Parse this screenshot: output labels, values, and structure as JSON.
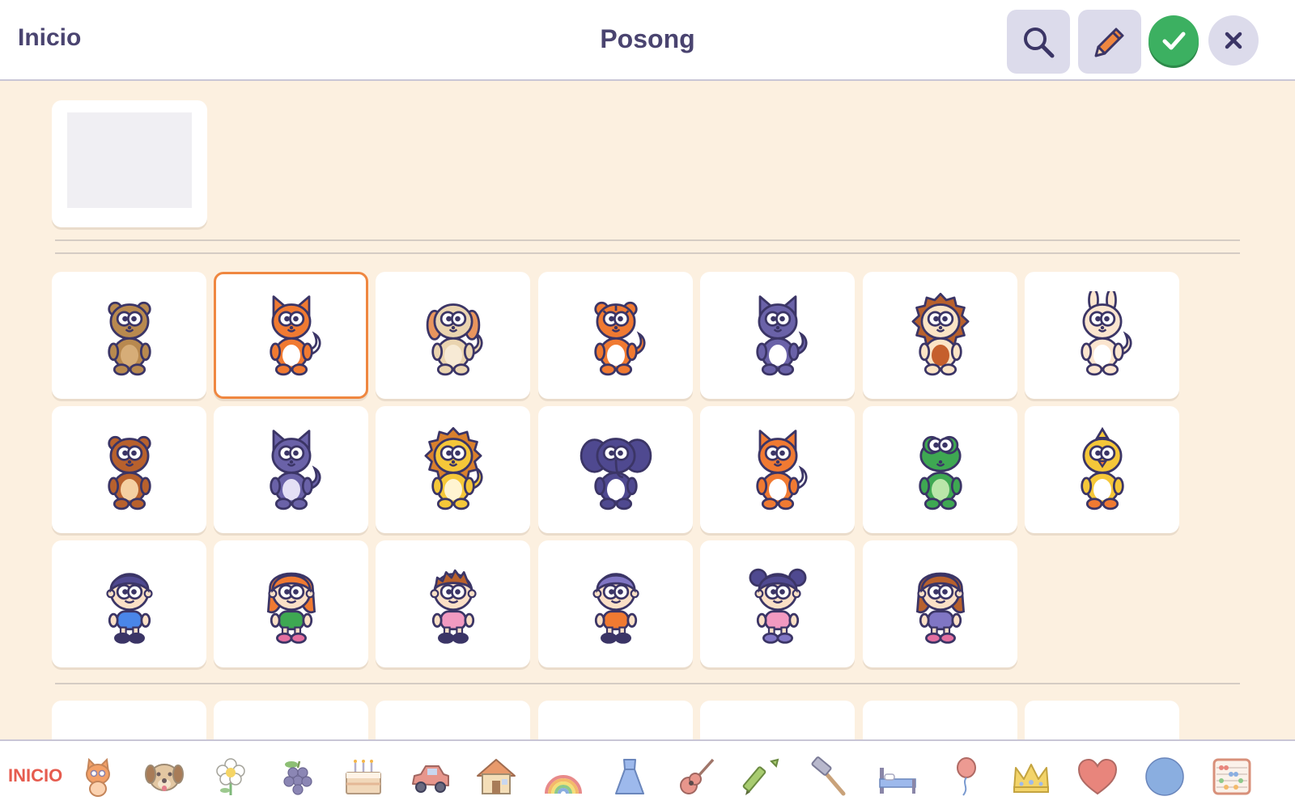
{
  "header": {
    "home_label": "Inicio",
    "title": "Posong",
    "buttons": [
      {
        "name": "search-button",
        "icon": "search-icon"
      },
      {
        "name": "edit-button",
        "icon": "pencil-icon"
      },
      {
        "name": "confirm-button",
        "icon": "check-icon"
      },
      {
        "name": "close-button",
        "icon": "close-icon"
      }
    ]
  },
  "colors": {
    "background": "#fcf0e0",
    "header_text": "#4a4470",
    "selected_border": "#ef8740",
    "confirm_green": "#3cb061",
    "category_home": "#e65c4f"
  },
  "characters": [
    {
      "id": "bear-plain",
      "kind": "animal",
      "body": "#b8894f",
      "belly": "#d6ad78",
      "ears": "round",
      "selected": false
    },
    {
      "id": "fox",
      "kind": "animal",
      "body": "#f07a32",
      "belly": "#ffffff",
      "ears": "pointy",
      "tail": true,
      "selected": true
    },
    {
      "id": "puppy",
      "kind": "animal",
      "body": "#ead4b0",
      "belly": "#f7ead5",
      "ears": "floppy",
      "floppy": "#e8955e",
      "tail": true,
      "selected": false
    },
    {
      "id": "tiger",
      "kind": "animal",
      "body": "#f07a32",
      "belly": "#ffffff",
      "ears": "round",
      "stripes": true,
      "tail": true,
      "selected": false
    },
    {
      "id": "purple-cat",
      "kind": "animal",
      "body": "#6a62a8",
      "belly": "#ffffff",
      "ears": "pointy",
      "tail": true,
      "selected": false
    },
    {
      "id": "hedgehog",
      "kind": "animal",
      "body": "#fbe4c6",
      "belly": "#c55f2d",
      "ears": "spiky",
      "spikes": "#b8612d",
      "selected": false
    },
    {
      "id": "bunny",
      "kind": "animal",
      "body": "#fbe5cf",
      "belly": "#ffffff",
      "ears": "long",
      "tail": true,
      "selected": false
    },
    {
      "id": "brown-bear",
      "kind": "animal",
      "body": "#b8612d",
      "belly": "#f5d0a2",
      "ears": "round",
      "selected": false
    },
    {
      "id": "purple-raccoon",
      "kind": "animal",
      "body": "#6a62a8",
      "belly": "#e4e0f5",
      "ears": "pointy",
      "tail": true,
      "selected": false
    },
    {
      "id": "lion",
      "kind": "animal",
      "body": "#f5c739",
      "belly": "#fff4d1",
      "ears": "mane",
      "spikes": "#d9802d",
      "tail": true,
      "selected": false
    },
    {
      "id": "elephant",
      "kind": "animal",
      "body": "#4f4990",
      "belly": "#ffffff",
      "ears": "elephant",
      "selected": false
    },
    {
      "id": "squirrel",
      "kind": "animal",
      "body": "#f07a32",
      "belly": "#ffffff",
      "ears": "pointy",
      "tail": true,
      "selected": false
    },
    {
      "id": "frog",
      "kind": "animal",
      "body": "#3ea852",
      "belly": "#b9e6a9",
      "ears": "frog",
      "selected": false
    },
    {
      "id": "chick",
      "kind": "animal",
      "body": "#f5c739",
      "belly": "#ffffff",
      "ears": "tuft",
      "feet": "#f07a32",
      "selected": false
    },
    {
      "id": "boy-blue",
      "kind": "kid",
      "hair": "#4f4990",
      "shirt": "#4a86e8",
      "hairstyle": "short",
      "selected": false
    },
    {
      "id": "girl-green",
      "kind": "kid",
      "hair": "#f07a32",
      "shirt": "#3ea852",
      "hairstyle": "long",
      "shoes": "#e46fa0",
      "selected": false
    },
    {
      "id": "boy-pink",
      "kind": "kid",
      "hair": "#b8612d",
      "shirt": "#f29ac1",
      "hairstyle": "spiky",
      "selected": false
    },
    {
      "id": "kid-orange",
      "kind": "kid",
      "hair": "#8076c4",
      "shirt": "#f07a32",
      "hairstyle": "short",
      "selected": false
    },
    {
      "id": "girl-buns",
      "kind": "kid",
      "hair": "#4f4990",
      "shirt": "#f29ac1",
      "hairstyle": "buns",
      "shoes": "#8076c4",
      "selected": false
    },
    {
      "id": "girl-purple",
      "kind": "kid",
      "hair": "#b8612d",
      "shirt": "#8076c4",
      "hairstyle": "long",
      "shoes": "#e46fa0",
      "selected": false
    }
  ],
  "footer": {
    "home_label": "INICIO",
    "categories": [
      "cat-icon",
      "dog-icon",
      "flower-icon",
      "grapes-icon",
      "cake-icon",
      "car-icon",
      "house-icon",
      "rainbow-icon",
      "dress-icon",
      "guitar-icon",
      "crayon-icon",
      "hammer-icon",
      "bed-icon",
      "balloon-icon",
      "crown-icon",
      "heart-icon",
      "circle-icon",
      "abacus-icon"
    ]
  }
}
